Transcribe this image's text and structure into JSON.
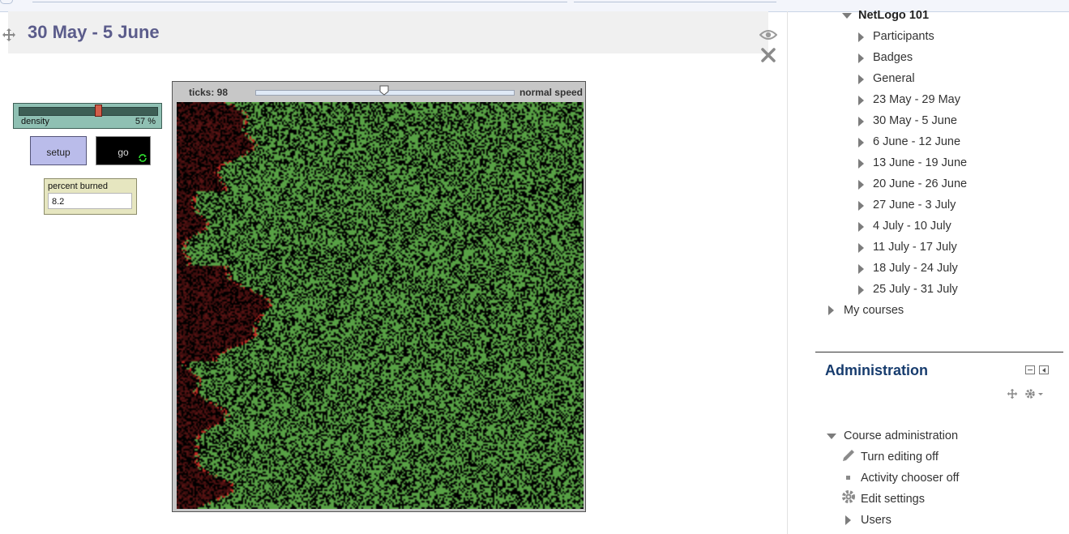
{
  "section": {
    "title": "30 May - 5 June"
  },
  "netlogo": {
    "slider": {
      "label": "density",
      "value": "57 %",
      "fraction": 0.57
    },
    "setup_label": "setup",
    "go_label": "go",
    "monitor": {
      "label": "percent burned",
      "value": "8.2"
    },
    "view": {
      "ticks": "ticks: 98",
      "speed_label": "normal speed",
      "speed_fraction": 0.5
    },
    "colors": {
      "tree": "#58a145",
      "empty": "#000000",
      "fire": "#c62a24",
      "ember": "#3d0d0d",
      "burned": "#5a1414"
    }
  },
  "nav": {
    "course": "NetLogo 101",
    "items": [
      "Participants",
      "Badges",
      "General",
      "23 May - 29 May",
      "30 May - 5 June",
      "6 June - 12 June",
      "13 June - 19 June",
      "20 June - 26 June",
      "27 June - 3 July",
      "4 July - 10 July",
      "11 July - 17 July",
      "18 July - 24 July",
      "25 July - 31 July"
    ],
    "my_courses": "My courses"
  },
  "admin": {
    "title": "Administration",
    "course_admin": "Course administration",
    "items": [
      {
        "label": "Turn editing off",
        "icon": "pencil-icon"
      },
      {
        "label": "Activity chooser off",
        "icon": "bullet-icon"
      },
      {
        "label": "Edit settings",
        "icon": "gear-icon"
      },
      {
        "label": "Users",
        "icon": "chevron-right-icon"
      }
    ]
  }
}
